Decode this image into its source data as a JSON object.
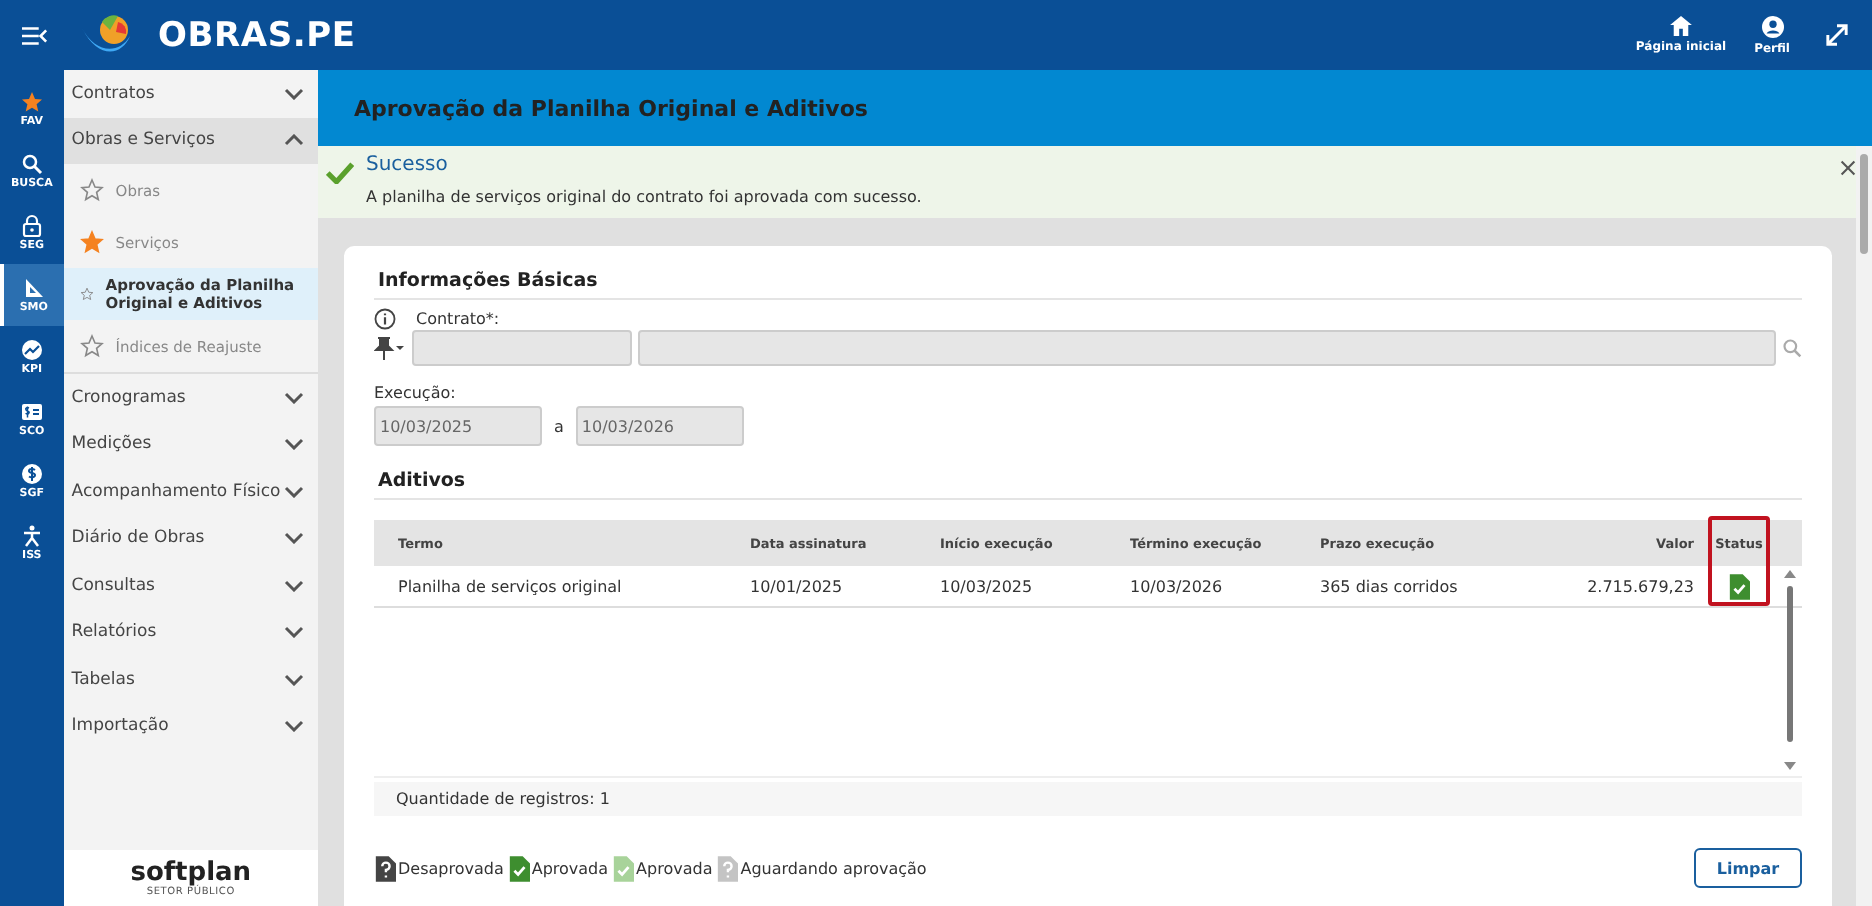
{
  "app": {
    "title": "OBRAS.PE"
  },
  "top_actions": [
    {
      "label": "Página inicial"
    },
    {
      "label": "Perfil"
    }
  ],
  "rail": [
    {
      "label": "FAV",
      "selected": false
    },
    {
      "label": "BUSCA",
      "selected": false
    },
    {
      "label": "SEG",
      "selected": false
    },
    {
      "label": "SMO",
      "selected": true
    },
    {
      "label": "KPI",
      "selected": false
    },
    {
      "label": "SCO",
      "selected": false
    },
    {
      "label": "SGF",
      "selected": false
    },
    {
      "label": "ISS",
      "selected": false
    }
  ],
  "menu": [
    {
      "label": "Contratos",
      "expanded": false
    },
    {
      "label": "Obras e Serviços",
      "expanded": true,
      "children": [
        {
          "label": "Obras",
          "starred": false,
          "selected": false
        },
        {
          "label": "Serviços",
          "starred": true,
          "selected": false
        },
        {
          "label": "Aprovação da Planilha Original e Aditivos",
          "starred": false,
          "selected": true
        },
        {
          "label": "Índices de Reajuste",
          "starred": false,
          "selected": false
        }
      ]
    },
    {
      "label": "Cronogramas",
      "expanded": false
    },
    {
      "label": "Medições",
      "expanded": false
    },
    {
      "label": "Acompanhamento Físico",
      "expanded": false
    },
    {
      "label": "Diário de Obras",
      "expanded": false
    },
    {
      "label": "Consultas",
      "expanded": false
    },
    {
      "label": "Relatórios",
      "expanded": false
    },
    {
      "label": "Tabelas",
      "expanded": false
    },
    {
      "label": "Importação",
      "expanded": false
    }
  ],
  "brand": {
    "name": "softplan",
    "subtitle": "SETOR PÚBLICO"
  },
  "page_title": "Aprovação da Planilha Original e Aditivos",
  "alert": {
    "title": "Sucesso",
    "message": "A planilha de serviços original do contrato foi aprovada com sucesso."
  },
  "form": {
    "section": "Informações Básicas",
    "contract_label": "Contrato*:",
    "execution_label": "Execução:",
    "start": "10/03/2025",
    "separator": "a",
    "end": "10/03/2026"
  },
  "aditivos": {
    "title": "Aditivos",
    "columns": [
      {
        "label": "Termo",
        "highlighted": false
      },
      {
        "label": "Data assinatura",
        "highlighted": false
      },
      {
        "label": "Início execução",
        "highlighted": false
      },
      {
        "label": "Término execução",
        "highlighted": false
      },
      {
        "label": "Prazo execução",
        "highlighted": false
      },
      {
        "label": "Valor",
        "highlighted": false
      },
      {
        "label": "Status",
        "highlighted": true
      }
    ],
    "rows": [
      {
        "cells": [
          "Planilha de serviços original",
          "10/01/2025",
          "10/03/2025",
          "10/03/2026",
          "365 dias corridos",
          "2.715.679,23"
        ],
        "status": {
          "kind": "approved"
        }
      }
    ],
    "count": "Quantidade de registros: 1"
  },
  "legend": [
    {
      "kind": "disapproved",
      "label": "Desaprovada"
    },
    {
      "kind": "approved",
      "label": "Aprovada"
    },
    {
      "kind": "approved_light",
      "label": "Aprovada"
    },
    {
      "kind": "pending",
      "label": "Aguardando aprovação"
    }
  ],
  "buttons": [
    "Limpar"
  ]
}
